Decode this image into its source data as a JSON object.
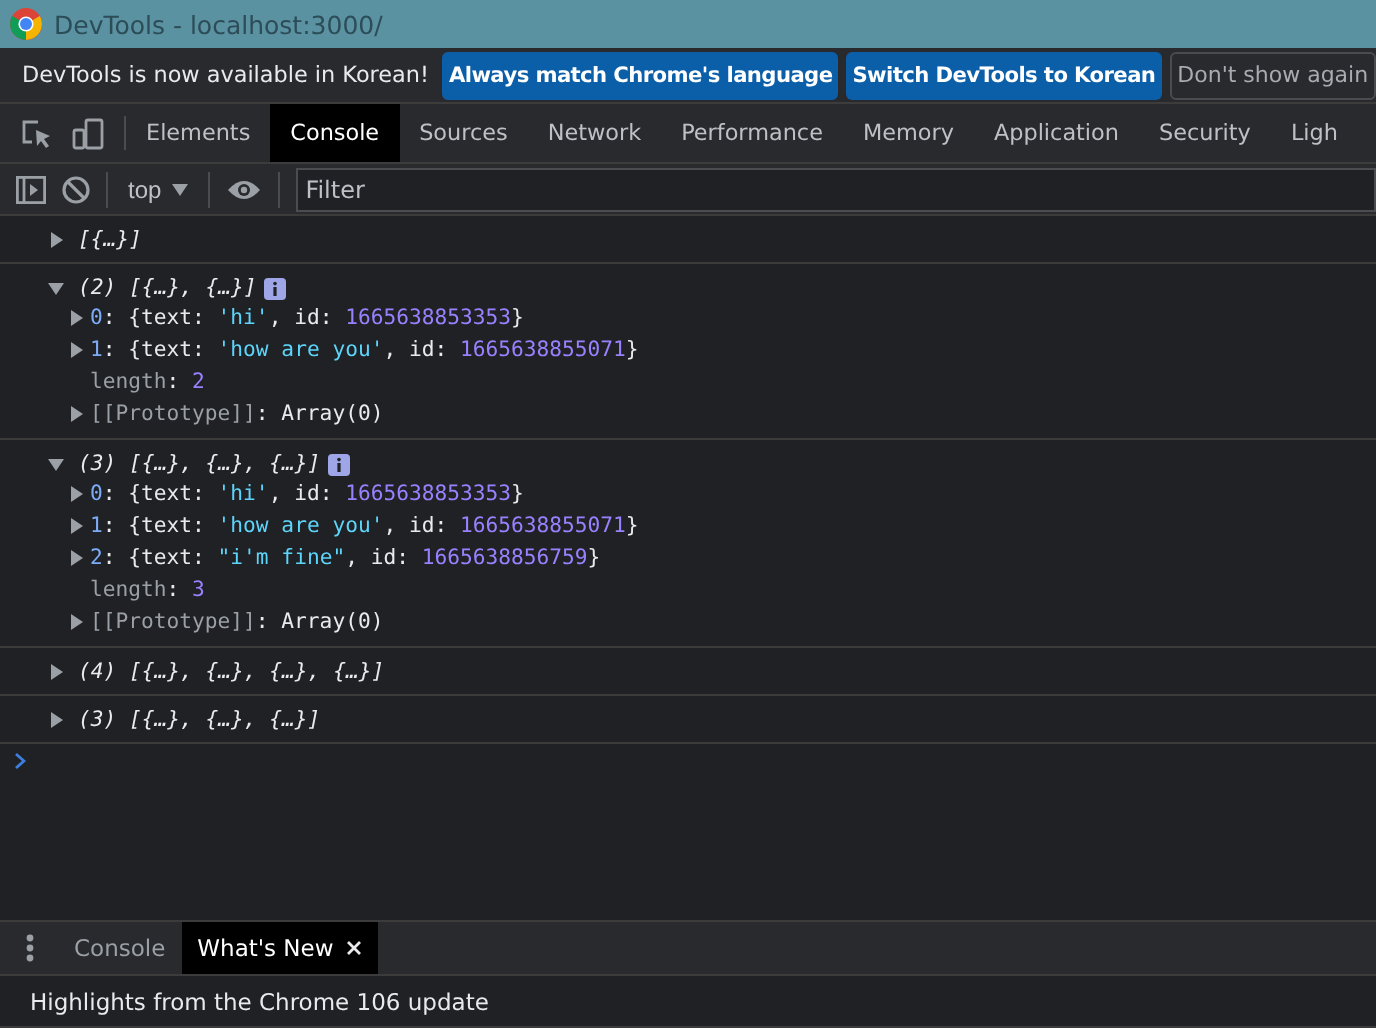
{
  "window": {
    "title": "DevTools - localhost:3000/"
  },
  "infobar": {
    "message": "DevTools is now available in Korean!",
    "buttons": [
      {
        "label": "Always match Chrome's language",
        "kind": "primary"
      },
      {
        "label": "Switch DevTools to Korean",
        "kind": "primary"
      },
      {
        "label": "Don't show again",
        "kind": "secondary"
      }
    ]
  },
  "tabs": [
    {
      "label": "Elements",
      "selected": false
    },
    {
      "label": "Console",
      "selected": true
    },
    {
      "label": "Sources",
      "selected": false
    },
    {
      "label": "Network",
      "selected": false
    },
    {
      "label": "Performance",
      "selected": false
    },
    {
      "label": "Memory",
      "selected": false
    },
    {
      "label": "Application",
      "selected": false
    },
    {
      "label": "Security",
      "selected": false
    },
    {
      "label": "Ligh",
      "selected": false
    }
  ],
  "toolbar": {
    "context": "top",
    "filter_placeholder": "Filter"
  },
  "console_entries": [
    {
      "expanded": false,
      "preview": "[{…}]"
    },
    {
      "expanded": true,
      "count": "(2)",
      "preview": "[{…}, {…}]",
      "info": true,
      "children": [
        {
          "expanded": false,
          "tokens": [
            {
              "kind": "index",
              "text": "0"
            },
            {
              "kind": "punct",
              "text": ": {text: "
            },
            {
              "kind": "string",
              "text": "'hi'"
            },
            {
              "kind": "punct",
              "text": ", id: "
            },
            {
              "kind": "number",
              "text": "1665638853353"
            },
            {
              "kind": "punct",
              "text": "}"
            }
          ]
        },
        {
          "expanded": false,
          "tokens": [
            {
              "kind": "index",
              "text": "1"
            },
            {
              "kind": "punct",
              "text": ": {text: "
            },
            {
              "kind": "string",
              "text": "'how are you'"
            },
            {
              "kind": "punct",
              "text": ", id: "
            },
            {
              "kind": "number",
              "text": "1665638855071"
            },
            {
              "kind": "punct",
              "text": "}"
            }
          ]
        },
        {
          "tokens": [
            {
              "kind": "internal",
              "text": "length"
            },
            {
              "kind": "punct",
              "text": ": "
            },
            {
              "kind": "number",
              "text": "2"
            }
          ]
        },
        {
          "expanded": false,
          "tokens": [
            {
              "kind": "internal",
              "text": "[[Prototype]]"
            },
            {
              "kind": "punct",
              "text": ": Array(0)"
            }
          ]
        }
      ]
    },
    {
      "expanded": true,
      "count": "(3)",
      "preview": "[{…}, {…}, {…}]",
      "info": true,
      "children": [
        {
          "expanded": false,
          "tokens": [
            {
              "kind": "index",
              "text": "0"
            },
            {
              "kind": "punct",
              "text": ": {text: "
            },
            {
              "kind": "string",
              "text": "'hi'"
            },
            {
              "kind": "punct",
              "text": ", id: "
            },
            {
              "kind": "number",
              "text": "1665638853353"
            },
            {
              "kind": "punct",
              "text": "}"
            }
          ]
        },
        {
          "expanded": false,
          "tokens": [
            {
              "kind": "index",
              "text": "1"
            },
            {
              "kind": "punct",
              "text": ": {text: "
            },
            {
              "kind": "string",
              "text": "'how are you'"
            },
            {
              "kind": "punct",
              "text": ", id: "
            },
            {
              "kind": "number",
              "text": "1665638855071"
            },
            {
              "kind": "punct",
              "text": "}"
            }
          ]
        },
        {
          "expanded": false,
          "tokens": [
            {
              "kind": "index",
              "text": "2"
            },
            {
              "kind": "punct",
              "text": ": {text: "
            },
            {
              "kind": "string",
              "text": "\"i'm fine\""
            },
            {
              "kind": "punct",
              "text": ", id: "
            },
            {
              "kind": "number",
              "text": "1665638856759"
            },
            {
              "kind": "punct",
              "text": "}"
            }
          ]
        },
        {
          "tokens": [
            {
              "kind": "internal",
              "text": "length"
            },
            {
              "kind": "punct",
              "text": ": "
            },
            {
              "kind": "number",
              "text": "3"
            }
          ]
        },
        {
          "expanded": false,
          "tokens": [
            {
              "kind": "internal",
              "text": "[[Prototype]]"
            },
            {
              "kind": "punct",
              "text": ": Array(0)"
            }
          ]
        }
      ]
    },
    {
      "expanded": false,
      "count": "(4)",
      "preview": "[{…}, {…}, {…}, {…}]"
    },
    {
      "expanded": false,
      "count": "(3)",
      "preview": "[{…}, {…}, {…}]"
    }
  ],
  "drawer": {
    "tabs": [
      {
        "label": "Console",
        "selected": false,
        "closable": false
      },
      {
        "label": "What's New",
        "selected": true,
        "closable": true
      }
    ],
    "content": "Highlights from the Chrome 106 update"
  }
}
